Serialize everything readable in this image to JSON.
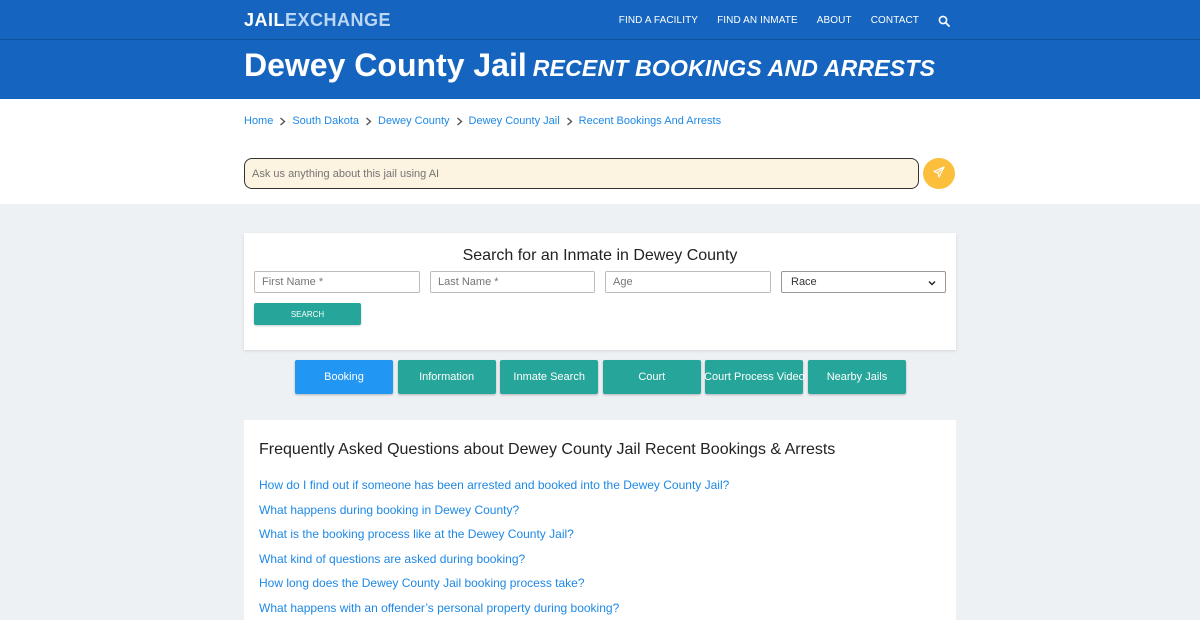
{
  "header": {
    "logo_a": "JAIL",
    "logo_b": "EXCHANGE",
    "nav": [
      "FIND A FACILITY",
      "FIND AN INMATE",
      "ABOUT",
      "CONTACT"
    ]
  },
  "title": {
    "main": "Dewey County Jail",
    "sub": "RECENT BOOKINGS AND ARRESTS"
  },
  "breadcrumb": [
    "Home",
    "South Dakota",
    "Dewey County",
    "Dewey County Jail",
    "Recent Bookings And Arrests"
  ],
  "ask": {
    "placeholder": "Ask us anything about this jail using AI"
  },
  "search": {
    "heading": "Search for an Inmate in Dewey County",
    "first_name_placeholder": "First Name *",
    "last_name_placeholder": "Last Name *",
    "age_placeholder": "Age",
    "race_selected": "Race",
    "button": "SEARCH"
  },
  "tabs": [
    "Booking",
    "Information",
    "Inmate Search",
    "Court",
    "Court Process Video",
    "Nearby Jails"
  ],
  "faq": {
    "heading": "Frequently Asked Questions about Dewey County Jail Recent Bookings & Arrests",
    "items": [
      "How do I find out if someone has been arrested and booked into the Dewey County Jail?",
      "What happens during booking in Dewey County?",
      "What is the booking process like at the Dewey County Jail?",
      "What kind of questions are asked during booking?",
      "How long does the Dewey County Jail booking process take?",
      "What happens with an offender’s personal property during booking?"
    ]
  },
  "colors": {
    "brand_blue": "#1565c0",
    "link_blue": "#1e88e5",
    "teal": "#26a69a",
    "active_tab": "#2196f3",
    "ask_button": "#fbbf3b"
  }
}
